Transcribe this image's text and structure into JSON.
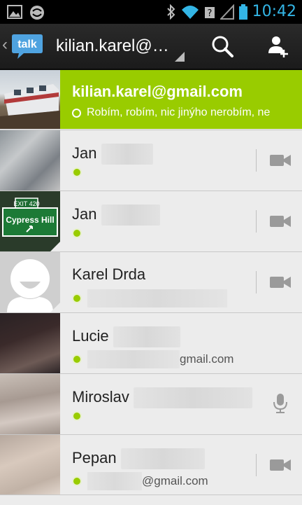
{
  "status_bar": {
    "time": "10:42"
  },
  "action_bar": {
    "logo_text": "talk",
    "account": "kilian.karel@…"
  },
  "self": {
    "email": "kilian.karel@gmail.com",
    "status": "Robím, robím, nic jinýho nerobím, ne"
  },
  "contacts": [
    {
      "name": "Jan",
      "status_text": "",
      "action": "video-icon"
    },
    {
      "name": "Jan",
      "status_text": "",
      "action": "video-icon",
      "avatar_sign": {
        "exit": "EXIT 420",
        "place": "Cypress Hill"
      }
    },
    {
      "name": "Karel Drda",
      "status_text": "",
      "action": "video-icon"
    },
    {
      "name": "Lucie",
      "status_text": "gmail.com",
      "action": "none"
    },
    {
      "name": "Miroslav",
      "status_text": "",
      "action": "microphone-icon"
    },
    {
      "name": "Pepan",
      "status_text": "@gmail.com",
      "action": "video-icon"
    }
  ],
  "colors": {
    "accent": "#99cc00",
    "presence": "#99cc00",
    "time": "#33b5e5"
  }
}
